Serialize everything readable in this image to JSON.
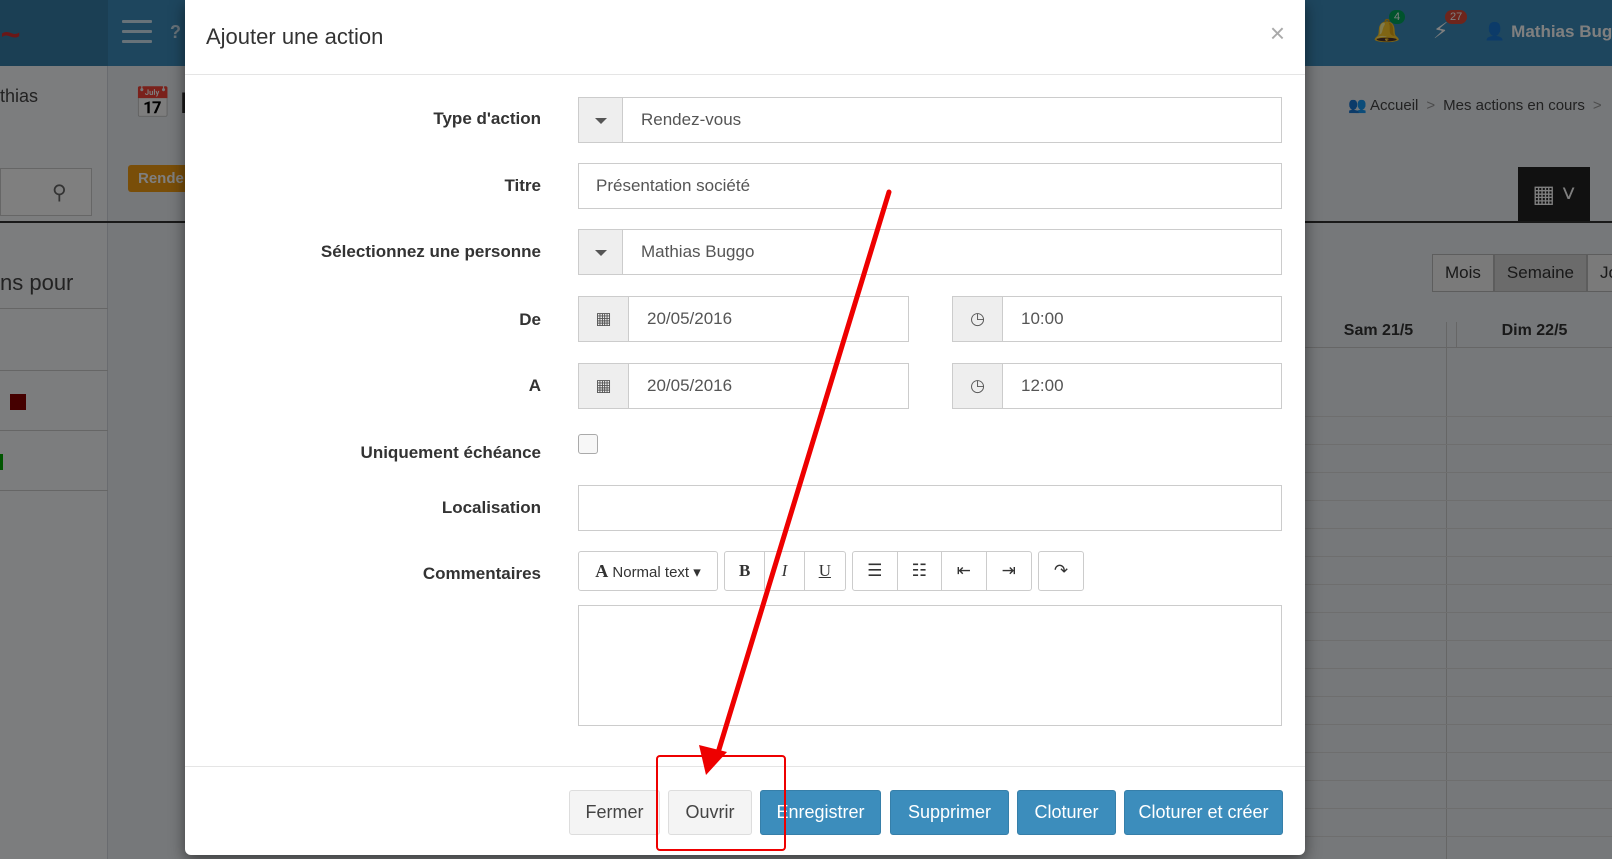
{
  "app": {
    "user_name": "Mathias Buggo",
    "notif_count": "4",
    "alert_count": "27",
    "sidebar_name": "thias",
    "page_title_fragment": "P",
    "breadcrumb": [
      "Accueil",
      "Mes actions en cours"
    ],
    "badge_fragment": "Rende",
    "left_panel_title_fragment": "ns pour",
    "view_buttons": [
      "Mois",
      "Semaine",
      "Jo"
    ],
    "calendar_days": [
      "Sam 21/5",
      "Dim 22/5"
    ]
  },
  "modal": {
    "title": "Ajouter une action",
    "close": "×",
    "labels": {
      "type": "Type d'action",
      "titre": "Titre",
      "personne": "Sélectionnez une personne",
      "de": "De",
      "a": "A",
      "echeance": "Uniquement échéance",
      "localisation": "Localisation",
      "commentaires": "Commentaires"
    },
    "values": {
      "type": "Rendez-vous",
      "titre": "Présentation société",
      "personne": "Mathias Buggo",
      "de_date": "20/05/2016",
      "de_time": "10:00",
      "a_date": "20/05/2016",
      "a_time": "12:00",
      "localisation": ""
    },
    "toolbar": {
      "text_style": "Normal text"
    },
    "buttons": {
      "fermer": "Fermer",
      "ouvrir": "Ouvrir",
      "enregistrer": "Enregistrer",
      "supprimer": "Supprimer",
      "cloturer": "Cloturer",
      "cloturer_creer": "Cloturer et créer"
    }
  },
  "colors": {
    "primary": "#3c8dbc",
    "annotation": "#ee0000"
  }
}
